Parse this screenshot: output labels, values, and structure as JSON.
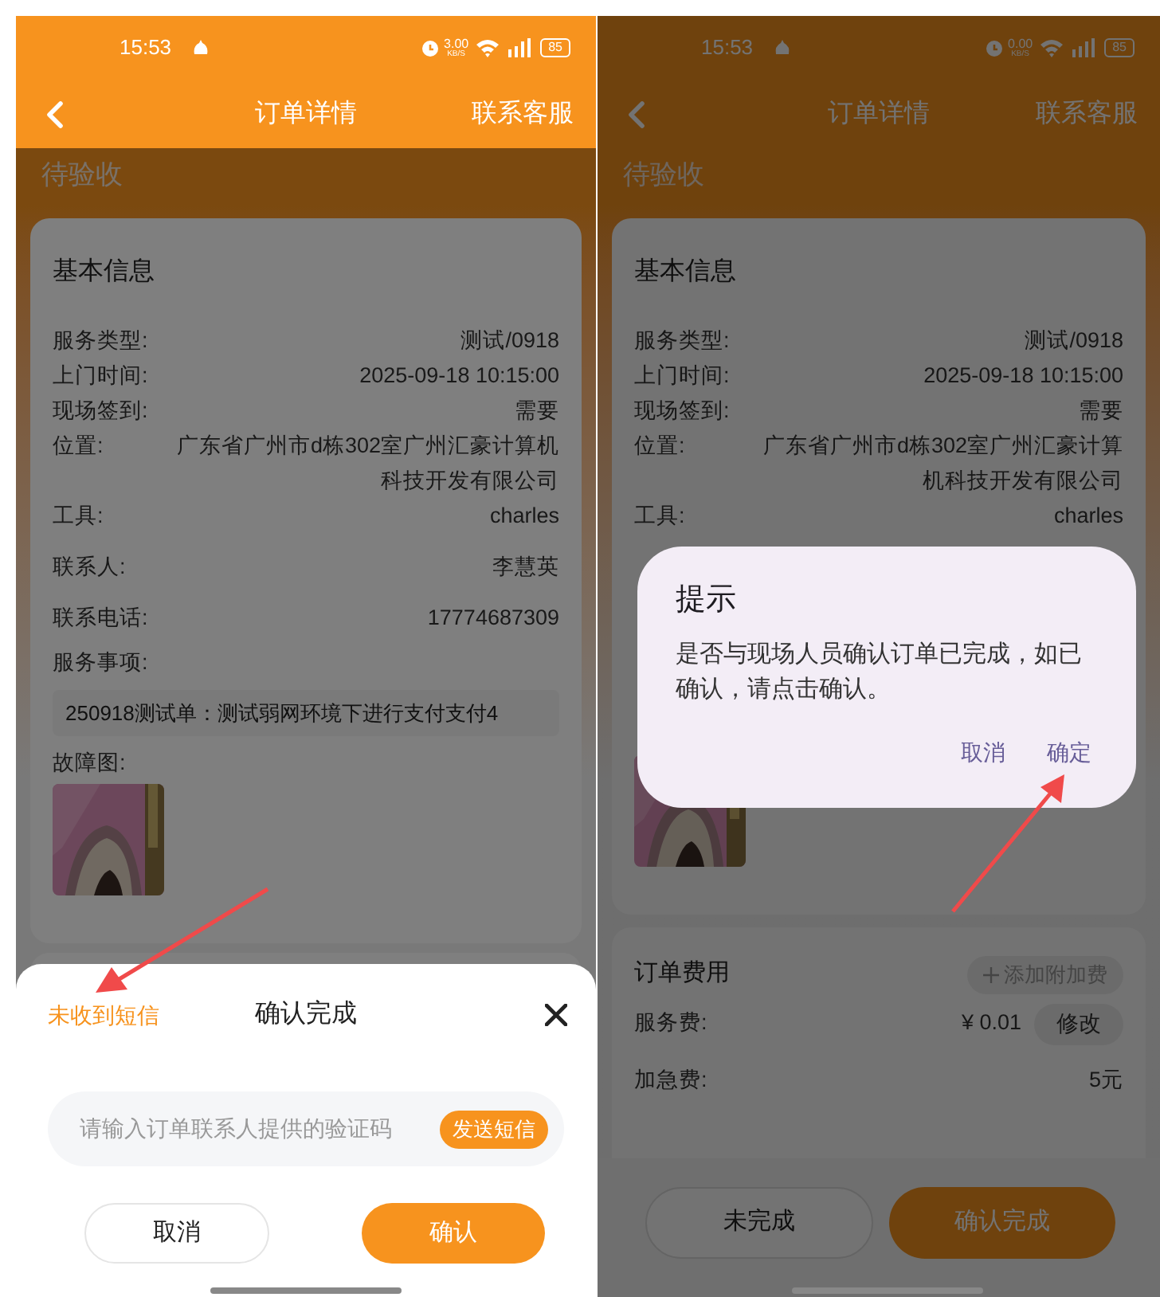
{
  "left_screen": {
    "status_bar": {
      "time": "15:53",
      "speed": "3.00",
      "speed_unit": "KB/S",
      "battery": "85"
    },
    "header": {
      "title": "订单详情",
      "action": "联系客服"
    },
    "order_status": "待验收",
    "info_card": {
      "title": "基本信息",
      "rows": [
        {
          "label": "服务类型:",
          "value": "测试/0918"
        },
        {
          "label": "上门时间:",
          "value": "2025-09-18 10:15:00"
        },
        {
          "label": "现场签到:",
          "value": "需要"
        },
        {
          "label": "位置:",
          "value": "广东省广州市d栋302室广州汇豪计算机科技开发有限公司"
        },
        {
          "label": "工具:",
          "value": "charles"
        },
        {
          "label": "联系人:",
          "value": "李慧英"
        },
        {
          "label": "联系电话:",
          "value": "17774687309"
        }
      ],
      "service_label": "服务事项:",
      "service_text": "250918测试单：测试弱网环境下进行支付支付4",
      "photo_label": "故障图:"
    },
    "sheet": {
      "sms_link": "未收到短信",
      "title": "确认完成",
      "input": {
        "placeholder": "请输入订单联系人提供的验证码"
      },
      "send_button": "发送短信",
      "cancel": "取消",
      "confirm": "确认"
    }
  },
  "right_screen": {
    "status_bar": {
      "time": "15:53",
      "speed": "0.00",
      "speed_unit": "KB/S",
      "battery": "85"
    },
    "header": {
      "title": "订单详情",
      "action": "联系客服"
    },
    "order_status": "待验收",
    "info_card": {
      "title": "基本信息",
      "rows": [
        {
          "label": "服务类型:",
          "value": "测试/0918"
        },
        {
          "label": "上门时间:",
          "value": "2025-09-18 10:15:00"
        },
        {
          "label": "现场签到:",
          "value": "需要"
        },
        {
          "label": "位置:",
          "value": "广东省广州市d栋302室广州汇豪计算机科技开发有限公司"
        },
        {
          "label": "工具:",
          "value": "charles"
        }
      ]
    },
    "fee_card": {
      "title": "订单费用",
      "add_button": "添加附加费",
      "rows": [
        {
          "label": "服务费:",
          "value": "¥ 0.01",
          "button": "修改"
        },
        {
          "label": "加急费:",
          "value": "5元"
        }
      ]
    },
    "bottom_bar": {
      "secondary": "未完成",
      "primary": "确认完成"
    },
    "dialog": {
      "title": "提示",
      "message": "是否与现场人员确认订单已完成，如已确认，请点击确认。",
      "cancel": "取消",
      "ok": "确定"
    }
  }
}
